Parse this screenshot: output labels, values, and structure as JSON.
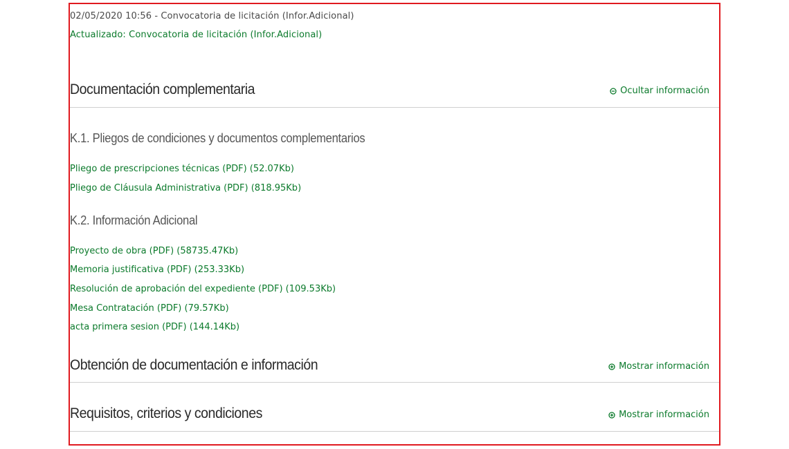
{
  "notice": {
    "entry": "02/05/2020 10:56 - Convocatoria de licitación (Infor.Adicional)",
    "updated": "Actualizado: Convocatoria de licitación (Infor.Adicional)"
  },
  "sections": {
    "documentacion": {
      "title": "Documentación complementaria",
      "toggle_label": "Ocultar información",
      "toggle_icon": "minus-circle-icon",
      "k1": {
        "title": "K.1. Pliegos de condiciones y documentos complementarios",
        "links": [
          "Pliego de prescripciones técnicas (PDF) (52.07Kb)",
          "Pliego de Cláusula Administrativa (PDF) (818.95Kb)"
        ]
      },
      "k2": {
        "title": "K.2. Información Adicional",
        "links": [
          "Proyecto de obra (PDF) (58735.47Kb)",
          "Memoria justificativa (PDF) (253.33Kb)",
          "Resolución de aprobación del expediente (PDF) (109.53Kb)",
          "Mesa Contratación (PDF) (79.57Kb)",
          "acta primera sesion (PDF) (144.14Kb)"
        ]
      }
    },
    "obtencion": {
      "title": "Obtención de documentación e información",
      "toggle_label": "Mostrar información",
      "toggle_icon": "plus-circle-icon"
    },
    "requisitos": {
      "title": "Requisitos, criterios y condiciones",
      "toggle_label": "Mostrar información",
      "toggle_icon": "plus-circle-icon"
    }
  },
  "colors": {
    "link_green": "#0b7a2b",
    "frame_red": "#e0191f",
    "divider": "#cfcfcf"
  }
}
